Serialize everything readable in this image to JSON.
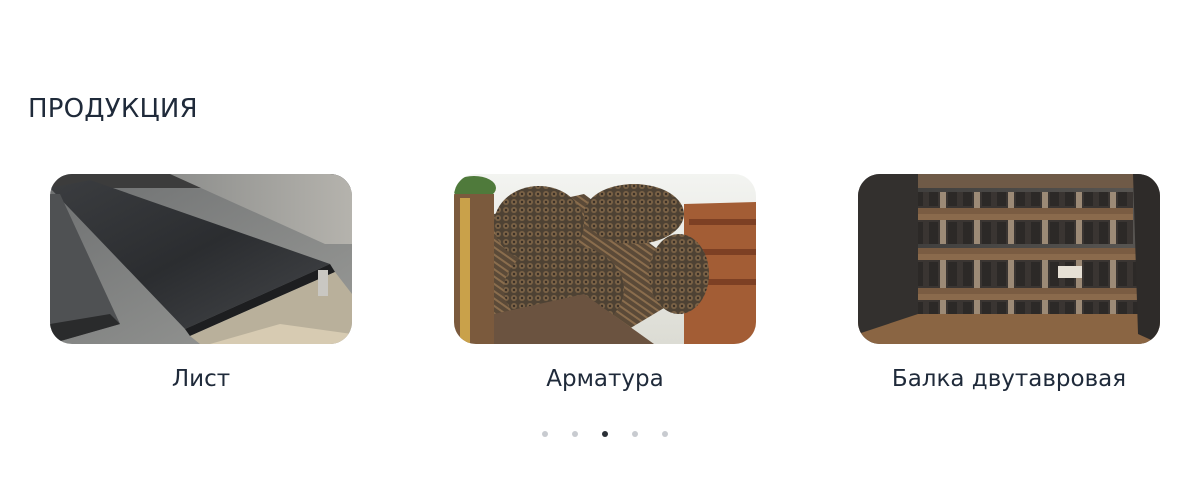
{
  "section": {
    "title": "ПРОДУКЦИЯ"
  },
  "products": [
    {
      "caption": "Лист",
      "image_icon": "steel-sheet-photo"
    },
    {
      "caption": "Арматура",
      "image_icon": "rebar-bundle-photo"
    },
    {
      "caption": "Балка двутавровая",
      "image_icon": "i-beam-photo"
    }
  ],
  "carousel": {
    "dot_count": 5,
    "active_index": 3
  },
  "colors": {
    "text": "#1f2a3a",
    "dot_inactive": "#c8cbd0",
    "dot_active": "#2a2f36"
  }
}
